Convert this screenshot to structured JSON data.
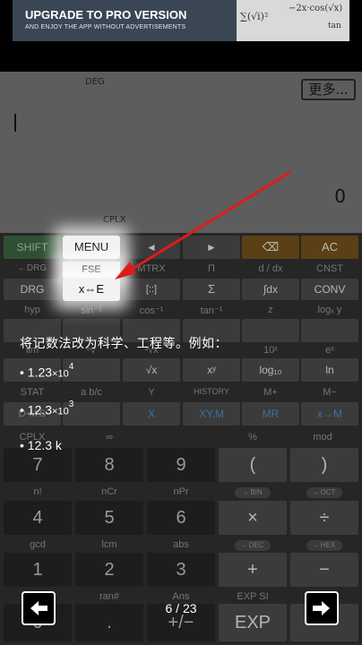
{
  "banner": {
    "title": "UPGRADE TO PRO VERSION",
    "subtitle": "AND ENJOY THE APP WITHOUT ADVERTISEMENTS"
  },
  "display": {
    "angle_mode": "DEG",
    "more_button": "更多...",
    "result": "0",
    "complex_mode": "CPLX"
  },
  "keypad": {
    "row1": {
      "shift": "SHIFT",
      "menu": "MENU",
      "left": "◄",
      "right": "►",
      "backspace": "⌫",
      "ac": "AC"
    },
    "row2_shift": {
      "drg_back": "←DRG",
      "fse": "FSE",
      "mtrx": "MTRX",
      "pi": "Π",
      "ddx": "d / dx",
      "cnst": "CNST"
    },
    "row2": {
      "drg": "DRG",
      "xe": "x⇔E",
      "matrix": "[::]",
      "sum": "Σ",
      "integral": "∫dx",
      "conv": "CONV"
    },
    "row3_shift": {
      "hyp": "hyp",
      "asin": "sin⁻¹",
      "acos": "cos⁻¹",
      "atan": "tan⁻¹",
      "z": "z",
      "logx": "logₓ y"
    },
    "row4_shift": {
      "lim": "lim",
      "rt": "ⁿ√",
      "sqrt": "³√x",
      "e10": "10ˣ",
      "ex": "eˣ"
    },
    "row4": {
      "sqrtx": "√x",
      "xy": "xʸ",
      "log10": "log₁₀",
      "ln": "ln"
    },
    "row5_shift": {
      "stat": "STAT",
      "abc": "a b/c",
      "y": "Y",
      "history": "HISTORY",
      "mplus": "M+",
      "mminus": "M−"
    },
    "row5": {
      "dms": "D◦M'S",
      "x": "X",
      "xym": "XY,M",
      "mr": "MR",
      "xtom": "x→M"
    },
    "row6_shift": {
      "cplx": "CPLX",
      "inf": "∞",
      "pct": "%",
      "mod": "mod"
    },
    "row6": {
      "n7": "7",
      "n8": "8",
      "n9": "9",
      "lparen": "(",
      "rparen": ")"
    },
    "row7_shift": {
      "n1": "n!",
      "ncr": "nCr",
      "npr": "nPr",
      "bin": "←BIN",
      "oct": "←OCT"
    },
    "row7": {
      "n4": "4",
      "n5": "5",
      "n6": "6",
      "times": "×",
      "divide": "÷"
    },
    "row8_shift": {
      "gcd": "gcd",
      "lcm": "lcm",
      "abs": "abs",
      "dec": "←DEC",
      "hex": "←HEX"
    },
    "row8": {
      "n1": "1",
      "n2": "2",
      "n3": "3",
      "plus": "+",
      "minus": "−"
    },
    "row9_shift": {
      "ran": "ran#",
      "ans": "Ans",
      "expsi": "EXP SI"
    },
    "row9": {
      "n0": "0",
      "dot": ".",
      "pm": "+/−",
      "exp": "EXP"
    }
  },
  "tutorial": {
    "title": "将记数法改为科学、工程等。例如：",
    "ex1_mantissa": "1.23",
    "ex1_exponent": "4",
    "ex2_mantissa": "12.3",
    "ex2_exponent": "3",
    "ex3": "12.3 k",
    "times_symbol": "×10",
    "bullet": "•",
    "page": "6 / 23"
  },
  "icons": {
    "prev": "arrow-left-icon",
    "next": "arrow-right-icon",
    "pointer": "red-arrow-pointer"
  },
  "colors": {
    "pointer": "#e01b1b",
    "shift_key": "#2e6b3b",
    "backspace_key": "#7a5312",
    "ac_key": "#7a5312"
  }
}
